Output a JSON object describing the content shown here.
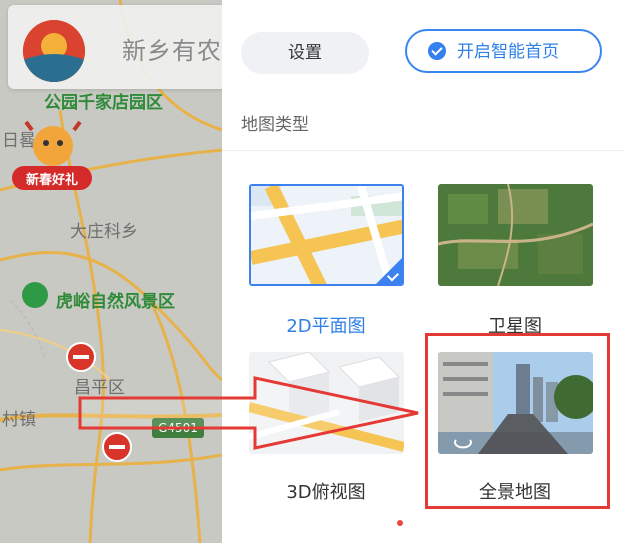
{
  "map": {
    "search_text": "新乡有农",
    "labels": {
      "park_district": "公园千家店园区",
      "rijiao": "日晷",
      "dazhuangke": "大庄科乡",
      "hushan": "虎峪自然风景区",
      "changping": "昌平区",
      "cunzhen": "村镇"
    },
    "mascot_text": "新春好礼",
    "highway_shield": "G4501"
  },
  "panel": {
    "settings_label": "设置",
    "smart_home_label": "开启智能首页",
    "section_title": "地图类型",
    "map_types": [
      {
        "label": "2D平面图",
        "selected": true
      },
      {
        "label": "卫星图",
        "selected": false
      },
      {
        "label": "3D俯视图",
        "selected": false
      },
      {
        "label": "全景地图",
        "selected": false
      }
    ]
  },
  "colors": {
    "accent": "#2f7fe8",
    "highlight": "#e53935"
  }
}
